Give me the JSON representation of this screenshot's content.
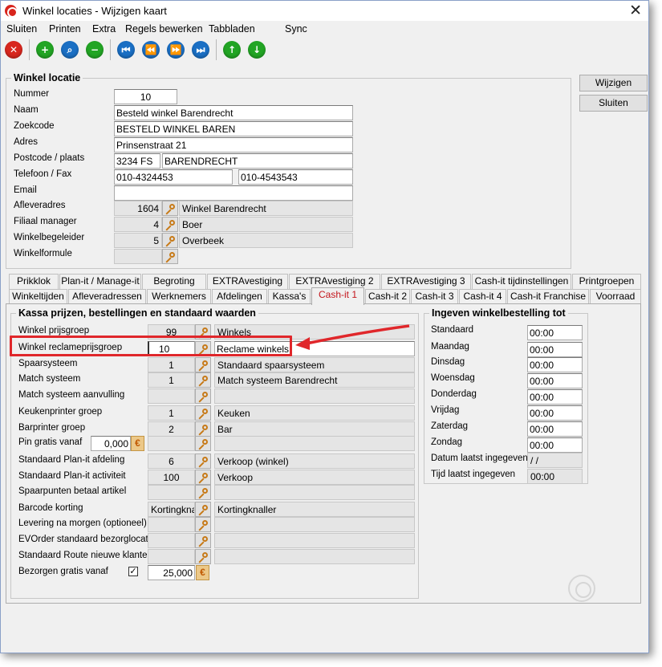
{
  "window": {
    "title": "Winkel locaties - Wijzigen kaart"
  },
  "menu": [
    "Sluiten",
    "Printen",
    "Extra",
    "Regels bewerken",
    "Tabbladen",
    "Sync"
  ],
  "buttons": {
    "wijzigen": "Wijzigen",
    "sluiten": "Sluiten"
  },
  "winkel_locatie": {
    "title": "Winkel locatie",
    "nummer_label": "Nummer",
    "nummer": "10",
    "naam_label": "Naam",
    "naam": "Besteld winkel Barendrecht",
    "zoekcode_label": "Zoekcode",
    "zoekcode": "BESTELD WINKEL BAREN",
    "adres_label": "Adres",
    "adres": "Prinsenstraat 21",
    "postcode_label": "Postcode / plaats",
    "postcode": "3234 FS",
    "plaats": "BARENDRECHT",
    "telefoon_label": "Telefoon / Fax",
    "telefoon": "010-4324453",
    "fax": "010-4543543",
    "email_label": "Email",
    "email": "",
    "afleveradres_label": "Afleveradres",
    "afleveradres_code": "1604",
    "afleveradres_naam": "Winkel Barendrecht",
    "filiaal_label": "Filiaal manager",
    "filiaal_code": "4",
    "filiaal_naam": "Boer",
    "begeleider_label": "Winkelbegeleider",
    "begeleider_code": "5",
    "begeleider_naam": "Overbeek",
    "formule_label": "Winkelformule"
  },
  "tabs_row1": [
    "Prikklok",
    "Plan-it / Manage-it",
    "Begroting",
    "EXTRAvestiging",
    "EXTRAvestiging 2",
    "EXTRAvestiging 3",
    "Cash-it tijdinstellingen",
    "Printgroepen"
  ],
  "tabs_row2": [
    "Winkeltijden",
    "Afleveradressen",
    "Werknemers",
    "Afdelingen",
    "Kassa's",
    "Cash-it 1",
    "Cash-it 2",
    "Cash-it 3",
    "Cash-it 4",
    "Cash-it Franchise",
    "Voorraad"
  ],
  "kassa": {
    "title": "Kassa prijzen, bestellingen en standaard waarden",
    "rows": [
      {
        "label": "Winkel prijsgroep",
        "code": "99",
        "desc": "Winkels"
      },
      {
        "label": "Winkel reclameprijsgroep",
        "code": "10",
        "desc": "Reclame winkels"
      },
      {
        "label": "Spaarsysteem",
        "code": "1",
        "desc": "Standaard spaarsysteem"
      },
      {
        "label": "Match systeem",
        "code": "1",
        "desc": "Match systeem Barendrecht"
      },
      {
        "label": "Match systeem aanvulling",
        "code": "",
        "desc": ""
      },
      {
        "label": "Keukenprinter groep",
        "code": "1",
        "desc": "Keuken"
      },
      {
        "label": "Barprinter groep",
        "code": "2",
        "desc": "Bar"
      },
      {
        "label": "Pin gratis vanaf",
        "code": "",
        "desc": ""
      },
      {
        "label": "Standaard Plan-it afdeling",
        "code": "6",
        "desc": "Verkoop (winkel)"
      },
      {
        "label": "Standaard Plan-it activiteit",
        "code": "100",
        "desc": "Verkoop"
      },
      {
        "label": "Spaarpunten betaal artikel",
        "code": "",
        "desc": ""
      },
      {
        "label": "Barcode korting",
        "code": "Kortingknall",
        "desc": "Kortingknaller"
      },
      {
        "label": "Levering na morgen (optioneel)",
        "code": "",
        "desc": ""
      },
      {
        "label": "EVOrder standaard bezorglocatie",
        "code": "",
        "desc": ""
      },
      {
        "label": "Standaard Route nieuwe klanten",
        "code": "",
        "desc": ""
      }
    ],
    "pin_gratis_value": "0,000",
    "bezorgen_label": "Bezorgen gratis vanaf",
    "bezorgen_value": "25,000",
    "bezorgen_checked": "✓"
  },
  "bestelling": {
    "title": "Ingeven winkelbestelling tot",
    "rows": [
      {
        "label": "Standaard",
        "value": "00:00"
      },
      {
        "label": "Maandag",
        "value": "00:00"
      },
      {
        "label": "Dinsdag",
        "value": "00:00"
      },
      {
        "label": "Woensdag",
        "value": "00:00"
      },
      {
        "label": "Donderdag",
        "value": "00:00"
      },
      {
        "label": "Vrijdag",
        "value": "00:00"
      },
      {
        "label": "Zaterdag",
        "value": "00:00"
      },
      {
        "label": "Zondag",
        "value": "00:00"
      }
    ],
    "datum_label": "Datum laatst ingegeven",
    "datum_value": "/ /",
    "tijd_label": "Tijd laatst ingegeven",
    "tijd_value": "00:00"
  },
  "colors": {
    "highlight": "#e0272b",
    "active_tab": "#c4161c"
  }
}
